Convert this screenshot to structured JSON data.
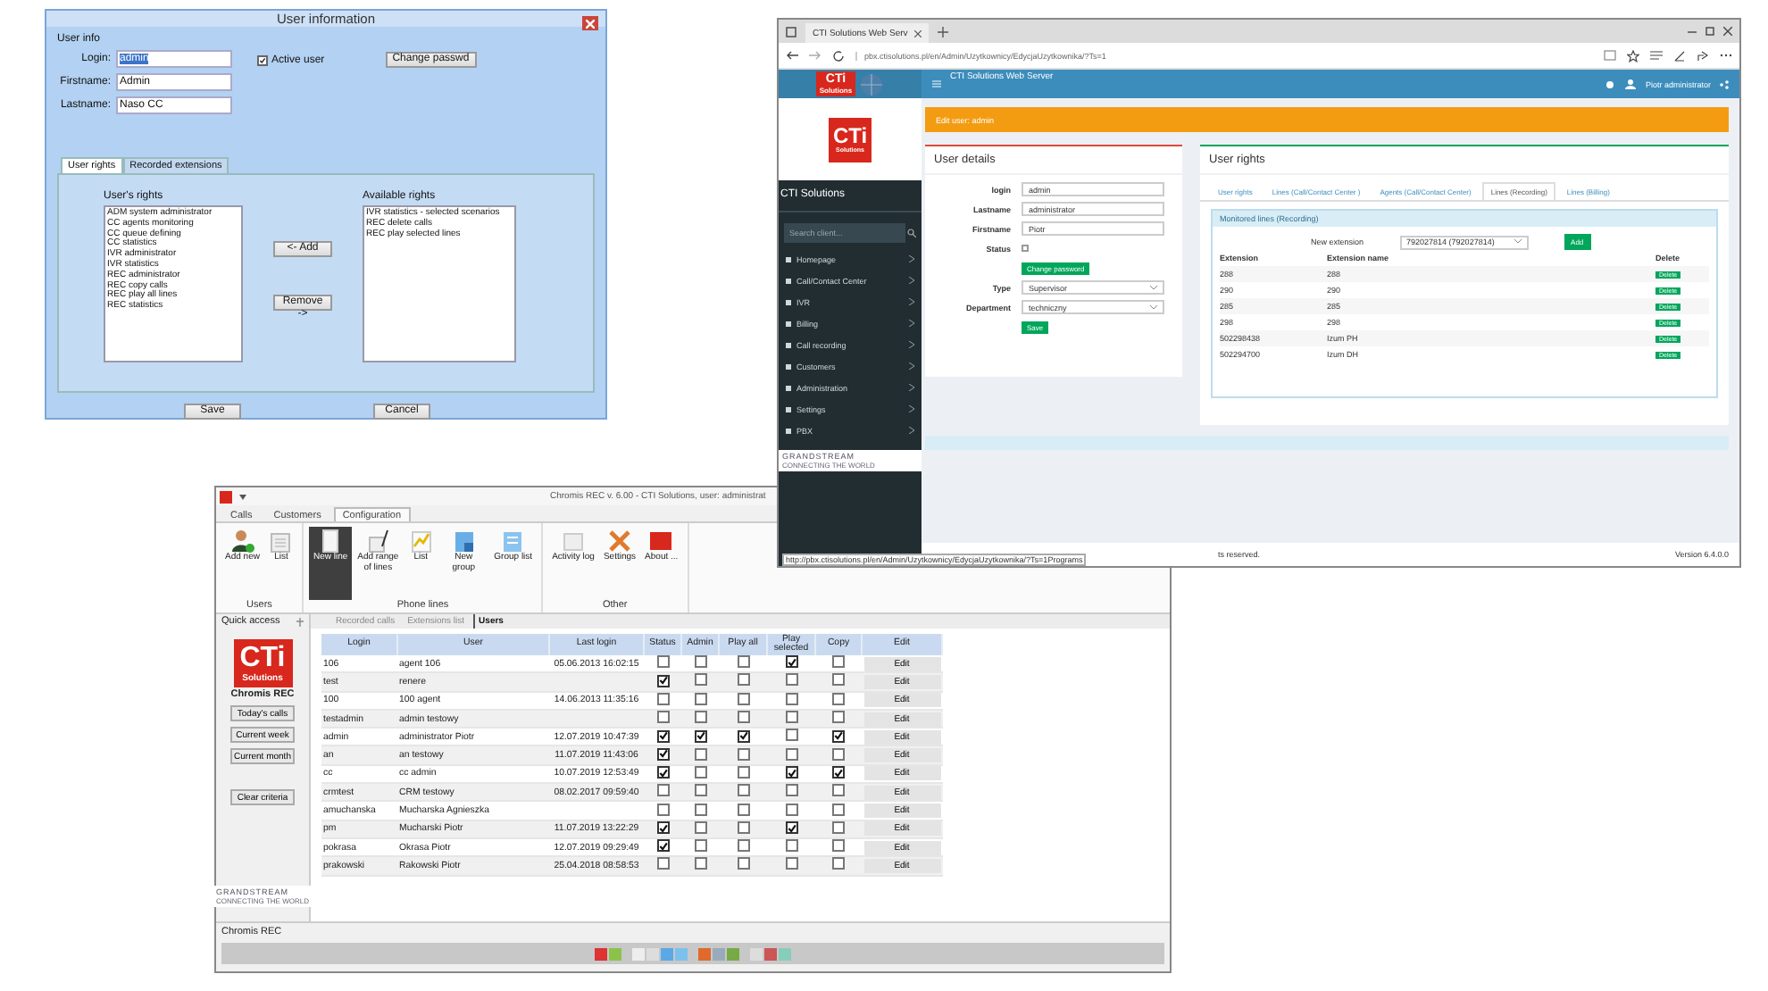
{
  "dialog": {
    "title": "User information",
    "section": "User info",
    "fields": [
      {
        "label": "Login:",
        "value": "admin",
        "selected": true
      },
      {
        "label": "Firstname:",
        "value": "Admin",
        "selected": false
      },
      {
        "label": "Lastname:",
        "value": "Naso CC",
        "selected": false
      }
    ],
    "active_user": {
      "label": "Active user",
      "checked": true
    },
    "change_password": "Change passwd",
    "tabs": [
      {
        "label": "User rights",
        "selected": true
      },
      {
        "label": "Recorded extensions",
        "selected": false
      }
    ],
    "users_rights": {
      "heading": "User's rights",
      "items": [
        "ADM system administrator",
        "CC agents monitoring",
        "CC queue defining",
        "CC statistics",
        "IVR administrator",
        "IVR statistics",
        "REC administrator",
        "REC copy calls",
        "REC play all lines",
        "REC statistics"
      ]
    },
    "available_rights": {
      "heading": "Available rights",
      "items": [
        "IVR statistics - selected scenarios",
        "REC delete calls",
        "REC play selected lines"
      ]
    },
    "add_button": "<- Add",
    "remove_button": "Remove ->",
    "buttons": [
      "Save",
      "Cancel"
    ]
  },
  "browser": {
    "tab_title": "CTI Solutions Web Serv",
    "url": "pbx.ctisolutions.pl/en/Admin/Uzytkownicy/EdycjaUzytkownika/?Ts=1",
    "header_title": "CTI Solutions Web Server",
    "user_name": "Piotr administrator",
    "header_logo": {
      "mark": "CTi",
      "sub": "Solutions"
    },
    "logo": {
      "mark": "CTi",
      "sub": "Solutions"
    },
    "brand": "CTI Solutions",
    "search_placeholder": "Search client...",
    "menu": [
      "Homepage",
      "Call/Contact Center",
      "IVR",
      "Billing",
      "Call recording",
      "Customers",
      "Administration",
      "Settings",
      "PBX"
    ],
    "partner_logo": {
      "name": "GRANDSTREAM",
      "tagline": "CONNECTING THE WORLD"
    },
    "alert": "Edit user: admin",
    "details": {
      "title": "User details",
      "fields": [
        {
          "kind": "text",
          "label": "login",
          "value": "admin"
        },
        {
          "kind": "text",
          "label": "Lastname",
          "value": "administrator"
        },
        {
          "kind": "text",
          "label": "Firstname",
          "value": "Piotr"
        },
        {
          "kind": "checkbox",
          "label": "Status",
          "checked": false
        },
        {
          "kind": "button",
          "value": "Change password"
        },
        {
          "kind": "select",
          "label": "Type",
          "value": "Supervisor"
        },
        {
          "kind": "select",
          "label": "Department",
          "value": "techniczny"
        },
        {
          "kind": "button",
          "value": "Save"
        }
      ]
    },
    "rights": {
      "title": "User rights",
      "tabs": [
        {
          "label": "User rights",
          "selected": false
        },
        {
          "label": "Lines (Call/Contact Center )",
          "selected": false
        },
        {
          "label": "Agents (Call/Contact Center)",
          "selected": false
        },
        {
          "label": "Lines (Recording)",
          "selected": true
        },
        {
          "label": "Lines (Billing)",
          "selected": false
        }
      ],
      "panel_title": "Monitored lines (Recording)",
      "new_extension_label": "New extension",
      "new_extension_value": "792027814 (792027814)",
      "add_button": "Add",
      "columns": [
        "Extension",
        "Extension name",
        "Delete"
      ],
      "rows": [
        {
          "extension": "288",
          "name": "288",
          "action": "Delete"
        },
        {
          "extension": "290",
          "name": "290",
          "action": "Delete"
        },
        {
          "extension": "285",
          "name": "285",
          "action": "Delete"
        },
        {
          "extension": "298",
          "name": "298",
          "action": "Delete"
        },
        {
          "extension": "502298438",
          "name": "Izum PH",
          "action": "Delete"
        },
        {
          "extension": "502294700",
          "name": "Izum DH",
          "action": "Delete"
        }
      ]
    },
    "status_url": "http://pbx.ctisolutions.pl/en/Admin/Uzytkownicy/EdycjaUzytkownika/?Ts=1Programs",
    "footer_text": "ts reserved.",
    "version": "Version 6.4.0.0"
  },
  "app": {
    "title": "Chromis REC  v. 6.00 - CTI Solutions, user: administrat",
    "tabs": [
      {
        "label": "Calls",
        "selected": false
      },
      {
        "label": "Customers",
        "selected": false
      },
      {
        "label": "Configuration",
        "selected": true
      }
    ],
    "ribbon": [
      {
        "label": "Users",
        "items": [
          {
            "kind": "person",
            "label": "Add new",
            "selected": false
          },
          {
            "kind": "list",
            "label": "List",
            "selected": false
          }
        ]
      },
      {
        "label": "Phone lines",
        "items": [
          {
            "kind": "line",
            "label": "New line",
            "selected": true
          },
          {
            "kind": "range",
            "label": "Add range of lines",
            "selected": false
          },
          {
            "kind": "chart",
            "label": "List",
            "selected": false
          },
          {
            "kind": "group",
            "label": "New group",
            "selected": false
          },
          {
            "kind": "grouplist",
            "label": "Group list",
            "selected": false
          }
        ]
      },
      {
        "label": "Other",
        "items": [
          {
            "kind": "log",
            "label": "Activity log",
            "selected": false
          },
          {
            "kind": "tools",
            "label": "Settings",
            "selected": false
          },
          {
            "kind": "about",
            "label": "About ...",
            "selected": false
          }
        ]
      }
    ],
    "quick_access": {
      "title": "Quick access",
      "logo": {
        "mark": "CTi",
        "sub": "Solutions"
      },
      "product": "Chromis REC",
      "buttons": [
        "Today's calls",
        "Current week",
        "Current month",
        "Clear criteria"
      ],
      "partner_logo": {
        "name": "GRANDSTREAM",
        "tagline": "CONNECTING THE WORLD"
      }
    },
    "doc_tabs": [
      {
        "label": "Recorded calls",
        "selected": false
      },
      {
        "label": "Extensions list",
        "selected": false
      },
      {
        "label": "Users",
        "selected": true
      }
    ],
    "columns": [
      "Login",
      "User",
      "Last login",
      "Status",
      "Admin",
      "Play all",
      "Play selected",
      "Copy",
      "Edit"
    ],
    "rows": [
      {
        "login": "106",
        "user": "agent 106",
        "last_login": "05.06.2013 16:02:15",
        "status": false,
        "admin": false,
        "play_all": false,
        "play_selected": true,
        "copy": false,
        "edit": "Edit"
      },
      {
        "login": "test",
        "user": "renere",
        "status": true,
        "admin": false,
        "play_all": false,
        "play_selected": false,
        "copy": false,
        "edit": "Edit"
      },
      {
        "login": "100",
        "user": "100 agent",
        "last_login": "14.06.2013 11:35:16",
        "status": false,
        "admin": false,
        "play_all": false,
        "play_selected": false,
        "copy": false,
        "edit": "Edit"
      },
      {
        "login": "testadmin",
        "user": "admin testowy",
        "status": false,
        "admin": false,
        "play_all": false,
        "play_selected": false,
        "copy": false,
        "edit": "Edit"
      },
      {
        "login": "admin",
        "user": "administrator Piotr",
        "last_login": "12.07.2019 10:47:39",
        "status": true,
        "admin": true,
        "play_all": true,
        "play_selected": false,
        "copy": true,
        "edit": "Edit"
      },
      {
        "login": "an",
        "user": "an testowy",
        "last_login": "11.07.2019 11:43:06",
        "status": true,
        "admin": false,
        "play_all": false,
        "play_selected": false,
        "copy": false,
        "edit": "Edit"
      },
      {
        "login": "cc",
        "user": "cc admin",
        "last_login": "10.07.2019 12:53:49",
        "status": true,
        "admin": false,
        "play_all": false,
        "play_selected": true,
        "copy": true,
        "edit": "Edit"
      },
      {
        "login": "crmtest",
        "user": "CRM testowy",
        "last_login": "08.02.2017 09:59:40",
        "status": false,
        "admin": false,
        "play_all": false,
        "play_selected": false,
        "copy": false,
        "edit": "Edit"
      },
      {
        "login": "amuchanska",
        "user": "Mucharska Agnieszka",
        "status": false,
        "admin": false,
        "play_all": false,
        "play_selected": false,
        "copy": false,
        "edit": "Edit"
      },
      {
        "login": "pm",
        "user": "Mucharski Piotr",
        "last_login": "11.07.2019 13:22:29",
        "status": true,
        "admin": false,
        "play_all": false,
        "play_selected": true,
        "copy": false,
        "edit": "Edit"
      },
      {
        "login": "pokrasa",
        "user": "Okrasa Piotr",
        "last_login": "12.07.2019 09:29:49",
        "status": true,
        "admin": false,
        "play_all": false,
        "play_selected": false,
        "copy": false,
        "edit": "Edit"
      },
      {
        "login": "prakowski",
        "user": "Rakowski Piotr",
        "last_login": "25.04.2018 08:58:53",
        "status": false,
        "admin": false,
        "play_all": false,
        "play_selected": false,
        "copy": false,
        "edit": "Edit"
      }
    ],
    "status_text": "Chromis REC"
  }
}
